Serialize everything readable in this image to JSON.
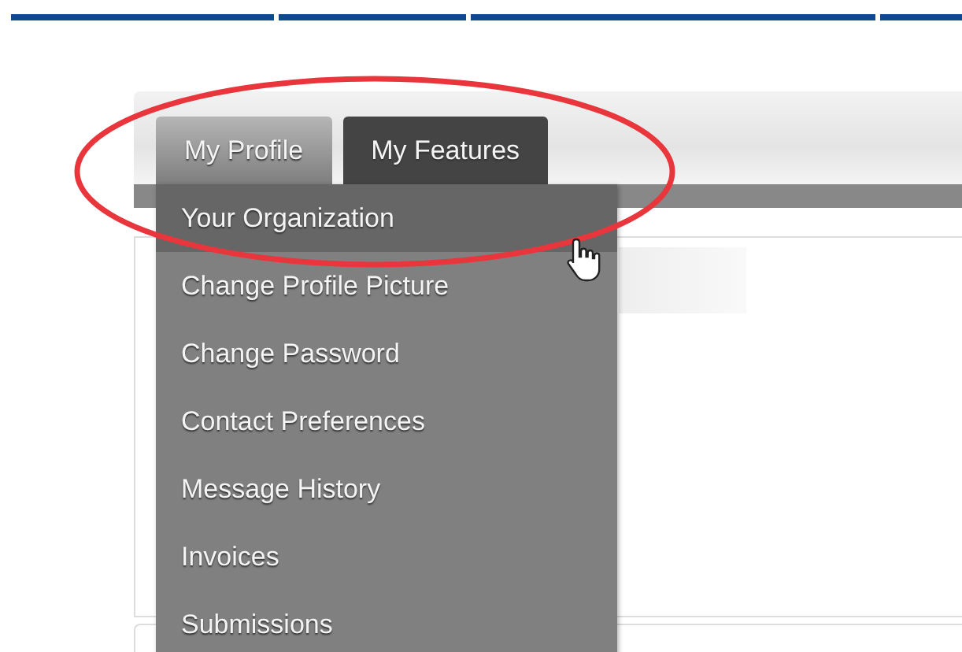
{
  "tabs": [
    {
      "label": "My Profile",
      "selected": true
    },
    {
      "label": "My Features",
      "selected": false
    }
  ],
  "dropdown": {
    "items": [
      {
        "label": "Your Organization",
        "selected": true
      },
      {
        "label": "Change Profile Picture",
        "selected": false
      },
      {
        "label": "Change Password",
        "selected": false
      },
      {
        "label": "Contact Preferences",
        "selected": false
      },
      {
        "label": "Message History",
        "selected": false
      },
      {
        "label": "Invoices",
        "selected": false
      },
      {
        "label": "Submissions",
        "selected": false
      }
    ]
  }
}
